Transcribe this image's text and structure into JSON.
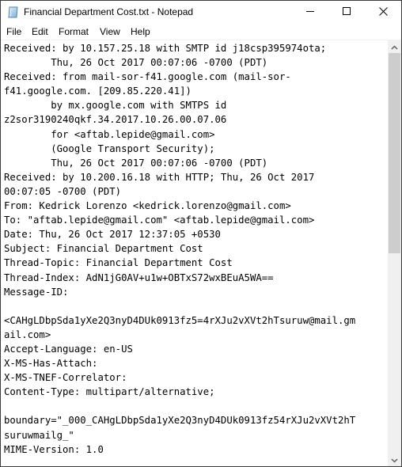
{
  "window": {
    "title": "Financial Department Cost.txt - Notepad",
    "app_icon": "notepad-icon",
    "controls": {
      "minimize": "minimize-icon",
      "maximize": "maximize-icon",
      "close": "close-icon"
    }
  },
  "menu": {
    "items": [
      {
        "label": "File"
      },
      {
        "label": "Edit"
      },
      {
        "label": "Format"
      },
      {
        "label": "View"
      },
      {
        "label": "Help"
      }
    ]
  },
  "editor": {
    "lines": [
      "Received: by 10.157.25.18 with SMTP id j18csp395974ota;",
      "        Thu, 26 Oct 2017 00:07:06 -0700 (PDT)",
      "Received: from mail-sor-f41.google.com (mail-sor-",
      "f41.google.com. [209.85.220.41])",
      "        by mx.google.com with SMTPS id",
      "z2sor3190240qkf.34.2017.10.26.00.07.06",
      "        for <aftab.lepide@gmail.com>",
      "        (Google Transport Security);",
      "        Thu, 26 Oct 2017 00:07:06 -0700 (PDT)",
      "Received: by 10.200.16.18 with HTTP; Thu, 26 Oct 2017",
      "00:07:05 -0700 (PDT)",
      "From: Kedrick Lorenzo <kedrick.lorenzo@gmail.com>",
      "To: \"aftab.lepide@gmail.com\" <aftab.lepide@gmail.com>",
      "Date: Thu, 26 Oct 2017 12:37:05 +0530",
      "Subject: Financial Department Cost",
      "Thread-Topic: Financial Department Cost",
      "Thread-Index: AdN1jG0AV+u1w+OBTxS72wxBEuA5WA==",
      "Message-ID:",
      "",
      "<CAHgLDbpSda1yXe2Q3nyD4DUk0913fz5=4rXJu2vXVt2hTsuruw@mail.gm",
      "ail.com>",
      "Accept-Language: en-US",
      "X-MS-Has-Attach:",
      "X-MS-TNEF-Correlator:",
      "Content-Type: multipart/alternative;",
      "",
      "boundary=\"_000_CAHgLDbpSda1yXe2Q3nyD4DUk0913fz54rXJu2vXVt2hT",
      "suruwmailg_\"",
      "MIME-Version: 1.0"
    ]
  },
  "scrollbar": {
    "up_icon": "chevron-up-icon",
    "down_icon": "chevron-down-icon",
    "position_fraction": 0.0,
    "visible_fraction": 0.5
  }
}
